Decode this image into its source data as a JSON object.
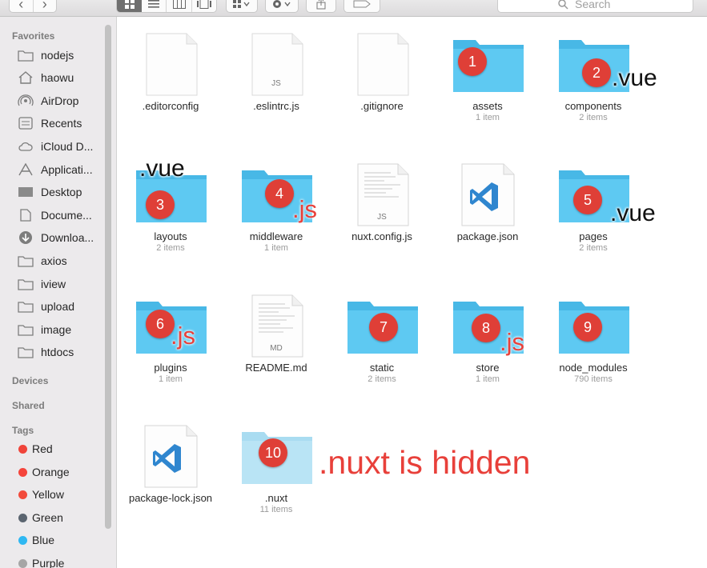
{
  "toolbar": {
    "back_glyph": "‹",
    "forward_glyph": "›",
    "search_placeholder": "Search"
  },
  "sidebar": {
    "favorites_header": "Favorites",
    "favorites": [
      {
        "label": "nodejs",
        "icon": "folder-icon"
      },
      {
        "label": "haowu",
        "icon": "home-icon"
      },
      {
        "label": "AirDrop",
        "icon": "airdrop-icon"
      },
      {
        "label": "Recents",
        "icon": "recents-icon"
      },
      {
        "label": "iCloud D...",
        "icon": "cloud-icon"
      },
      {
        "label": "Applicati...",
        "icon": "applications-icon"
      },
      {
        "label": "Desktop",
        "icon": "desktop-icon"
      },
      {
        "label": "Docume...",
        "icon": "documents-icon"
      },
      {
        "label": "Downloa...",
        "icon": "downloads-icon"
      },
      {
        "label": "axios",
        "icon": "folder-icon"
      },
      {
        "label": "iview",
        "icon": "folder-icon"
      },
      {
        "label": "upload",
        "icon": "folder-icon"
      },
      {
        "label": "image",
        "icon": "folder-icon"
      },
      {
        "label": "htdocs",
        "icon": "folder-icon"
      }
    ],
    "devices_header": "Devices",
    "shared_header": "Shared",
    "tags_header": "Tags",
    "tags": [
      {
        "label": "Red",
        "color": "#f0443a"
      },
      {
        "label": "Orange",
        "color": "#f5443b"
      },
      {
        "label": "Yellow",
        "color": "#f24b3c"
      },
      {
        "label": "Green",
        "color": "#5b6570"
      },
      {
        "label": "Blue",
        "color": "#2fb8f2"
      },
      {
        "label": "Purple",
        "color": "#a6a6a6"
      }
    ]
  },
  "files": [
    {
      "name": ".editorconfig",
      "count": "",
      "kind": "doc",
      "ext": ""
    },
    {
      "name": ".eslintrc.js",
      "count": "",
      "kind": "doc",
      "ext": "JS"
    },
    {
      "name": ".gitignore",
      "count": "",
      "kind": "doc",
      "ext": ""
    },
    {
      "name": "assets",
      "count": "1 item",
      "kind": "folder",
      "badge": "1"
    },
    {
      "name": "components",
      "count": "2 items",
      "kind": "folder",
      "badge": "2",
      "note": ".vue"
    },
    {
      "name": "layouts",
      "count": "2 items",
      "kind": "folder",
      "badge": "3",
      "note": ".vue"
    },
    {
      "name": "middleware",
      "count": "1 item",
      "kind": "folder",
      "badge": "4",
      "note": ".js"
    },
    {
      "name": "nuxt.config.js",
      "count": "",
      "kind": "doc",
      "ext": "JS"
    },
    {
      "name": "package.json",
      "count": "",
      "kind": "vscode",
      "ext": ""
    },
    {
      "name": "pages",
      "count": "2 items",
      "kind": "folder",
      "badge": "5",
      "note": ".vue"
    },
    {
      "name": "plugins",
      "count": "1 item",
      "kind": "folder",
      "badge": "6",
      "note": ".js"
    },
    {
      "name": "README.md",
      "count": "",
      "kind": "doc",
      "ext": "MD"
    },
    {
      "name": "static",
      "count": "2 items",
      "kind": "folder",
      "badge": "7"
    },
    {
      "name": "store",
      "count": "1 item",
      "kind": "folder",
      "badge": "8",
      "note": ".js"
    },
    {
      "name": "node_modules",
      "count": "790 items",
      "kind": "folder",
      "badge": "9"
    },
    {
      "name": "package-lock.json",
      "count": "",
      "kind": "vscode",
      "ext": ""
    },
    {
      "name": ".nuxt",
      "count": "11 items",
      "kind": "folder-faded",
      "badge": "10"
    }
  ],
  "annotation": {
    "hidden_note": ".nuxt is hidden"
  },
  "colors": {
    "folder": "#5ec9f2",
    "folder_tab": "#48b8e6",
    "badge": "#df3f37",
    "annotation": "#e8403a"
  }
}
